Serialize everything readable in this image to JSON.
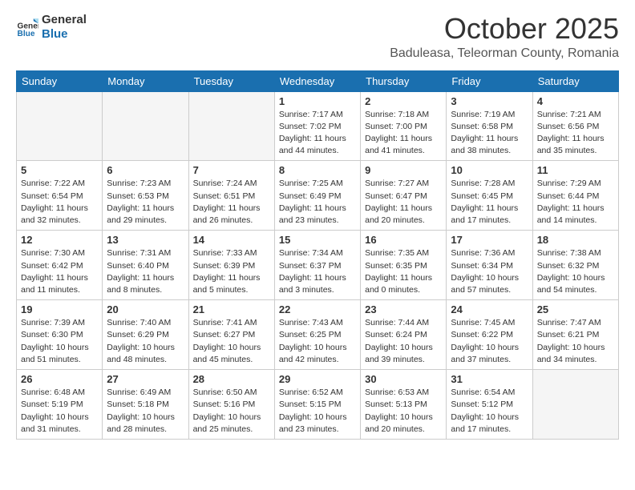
{
  "header": {
    "logo_general": "General",
    "logo_blue": "Blue",
    "month": "October 2025",
    "location": "Baduleasa, Teleorman County, Romania"
  },
  "weekdays": [
    "Sunday",
    "Monday",
    "Tuesday",
    "Wednesday",
    "Thursday",
    "Friday",
    "Saturday"
  ],
  "weeks": [
    [
      {
        "day": "",
        "empty": true
      },
      {
        "day": "",
        "empty": true
      },
      {
        "day": "",
        "empty": true
      },
      {
        "day": "1",
        "info": "Sunrise: 7:17 AM\nSunset: 7:02 PM\nDaylight: 11 hours and 44 minutes."
      },
      {
        "day": "2",
        "info": "Sunrise: 7:18 AM\nSunset: 7:00 PM\nDaylight: 11 hours and 41 minutes."
      },
      {
        "day": "3",
        "info": "Sunrise: 7:19 AM\nSunset: 6:58 PM\nDaylight: 11 hours and 38 minutes."
      },
      {
        "day": "4",
        "info": "Sunrise: 7:21 AM\nSunset: 6:56 PM\nDaylight: 11 hours and 35 minutes."
      }
    ],
    [
      {
        "day": "5",
        "info": "Sunrise: 7:22 AM\nSunset: 6:54 PM\nDaylight: 11 hours and 32 minutes."
      },
      {
        "day": "6",
        "info": "Sunrise: 7:23 AM\nSunset: 6:53 PM\nDaylight: 11 hours and 29 minutes."
      },
      {
        "day": "7",
        "info": "Sunrise: 7:24 AM\nSunset: 6:51 PM\nDaylight: 11 hours and 26 minutes."
      },
      {
        "day": "8",
        "info": "Sunrise: 7:25 AM\nSunset: 6:49 PM\nDaylight: 11 hours and 23 minutes."
      },
      {
        "day": "9",
        "info": "Sunrise: 7:27 AM\nSunset: 6:47 PM\nDaylight: 11 hours and 20 minutes."
      },
      {
        "day": "10",
        "info": "Sunrise: 7:28 AM\nSunset: 6:45 PM\nDaylight: 11 hours and 17 minutes."
      },
      {
        "day": "11",
        "info": "Sunrise: 7:29 AM\nSunset: 6:44 PM\nDaylight: 11 hours and 14 minutes."
      }
    ],
    [
      {
        "day": "12",
        "info": "Sunrise: 7:30 AM\nSunset: 6:42 PM\nDaylight: 11 hours and 11 minutes."
      },
      {
        "day": "13",
        "info": "Sunrise: 7:31 AM\nSunset: 6:40 PM\nDaylight: 11 hours and 8 minutes."
      },
      {
        "day": "14",
        "info": "Sunrise: 7:33 AM\nSunset: 6:39 PM\nDaylight: 11 hours and 5 minutes."
      },
      {
        "day": "15",
        "info": "Sunrise: 7:34 AM\nSunset: 6:37 PM\nDaylight: 11 hours and 3 minutes."
      },
      {
        "day": "16",
        "info": "Sunrise: 7:35 AM\nSunset: 6:35 PM\nDaylight: 11 hours and 0 minutes."
      },
      {
        "day": "17",
        "info": "Sunrise: 7:36 AM\nSunset: 6:34 PM\nDaylight: 10 hours and 57 minutes."
      },
      {
        "day": "18",
        "info": "Sunrise: 7:38 AM\nSunset: 6:32 PM\nDaylight: 10 hours and 54 minutes."
      }
    ],
    [
      {
        "day": "19",
        "info": "Sunrise: 7:39 AM\nSunset: 6:30 PM\nDaylight: 10 hours and 51 minutes."
      },
      {
        "day": "20",
        "info": "Sunrise: 7:40 AM\nSunset: 6:29 PM\nDaylight: 10 hours and 48 minutes."
      },
      {
        "day": "21",
        "info": "Sunrise: 7:41 AM\nSunset: 6:27 PM\nDaylight: 10 hours and 45 minutes."
      },
      {
        "day": "22",
        "info": "Sunrise: 7:43 AM\nSunset: 6:25 PM\nDaylight: 10 hours and 42 minutes."
      },
      {
        "day": "23",
        "info": "Sunrise: 7:44 AM\nSunset: 6:24 PM\nDaylight: 10 hours and 39 minutes."
      },
      {
        "day": "24",
        "info": "Sunrise: 7:45 AM\nSunset: 6:22 PM\nDaylight: 10 hours and 37 minutes."
      },
      {
        "day": "25",
        "info": "Sunrise: 7:47 AM\nSunset: 6:21 PM\nDaylight: 10 hours and 34 minutes."
      }
    ],
    [
      {
        "day": "26",
        "info": "Sunrise: 6:48 AM\nSunset: 5:19 PM\nDaylight: 10 hours and 31 minutes."
      },
      {
        "day": "27",
        "info": "Sunrise: 6:49 AM\nSunset: 5:18 PM\nDaylight: 10 hours and 28 minutes."
      },
      {
        "day": "28",
        "info": "Sunrise: 6:50 AM\nSunset: 5:16 PM\nDaylight: 10 hours and 25 minutes."
      },
      {
        "day": "29",
        "info": "Sunrise: 6:52 AM\nSunset: 5:15 PM\nDaylight: 10 hours and 23 minutes."
      },
      {
        "day": "30",
        "info": "Sunrise: 6:53 AM\nSunset: 5:13 PM\nDaylight: 10 hours and 20 minutes."
      },
      {
        "day": "31",
        "info": "Sunrise: 6:54 AM\nSunset: 5:12 PM\nDaylight: 10 hours and 17 minutes."
      },
      {
        "day": "",
        "empty": true
      }
    ]
  ]
}
